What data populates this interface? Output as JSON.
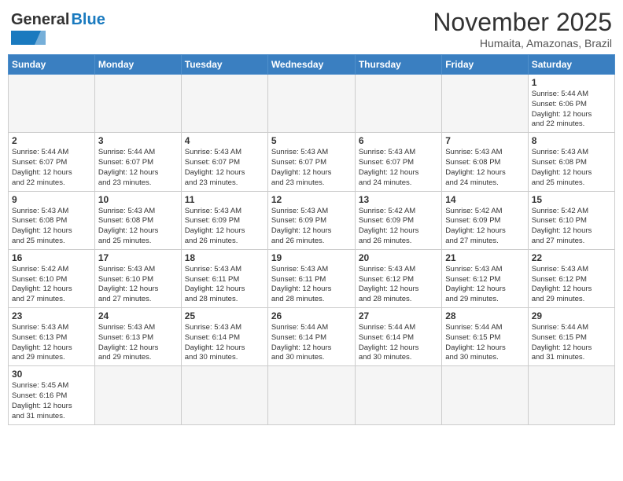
{
  "header": {
    "logo_text_normal": "General",
    "logo_text_blue": "Blue",
    "month_year": "November 2025",
    "location": "Humaita, Amazonas, Brazil"
  },
  "weekdays": [
    "Sunday",
    "Monday",
    "Tuesday",
    "Wednesday",
    "Thursday",
    "Friday",
    "Saturday"
  ],
  "weeks": [
    [
      {
        "day": "",
        "info": ""
      },
      {
        "day": "",
        "info": ""
      },
      {
        "day": "",
        "info": ""
      },
      {
        "day": "",
        "info": ""
      },
      {
        "day": "",
        "info": ""
      },
      {
        "day": "",
        "info": ""
      },
      {
        "day": "1",
        "info": "Sunrise: 5:44 AM\nSunset: 6:06 PM\nDaylight: 12 hours\nand 22 minutes."
      }
    ],
    [
      {
        "day": "2",
        "info": "Sunrise: 5:44 AM\nSunset: 6:07 PM\nDaylight: 12 hours\nand 22 minutes."
      },
      {
        "day": "3",
        "info": "Sunrise: 5:44 AM\nSunset: 6:07 PM\nDaylight: 12 hours\nand 23 minutes."
      },
      {
        "day": "4",
        "info": "Sunrise: 5:43 AM\nSunset: 6:07 PM\nDaylight: 12 hours\nand 23 minutes."
      },
      {
        "day": "5",
        "info": "Sunrise: 5:43 AM\nSunset: 6:07 PM\nDaylight: 12 hours\nand 23 minutes."
      },
      {
        "day": "6",
        "info": "Sunrise: 5:43 AM\nSunset: 6:07 PM\nDaylight: 12 hours\nand 24 minutes."
      },
      {
        "day": "7",
        "info": "Sunrise: 5:43 AM\nSunset: 6:08 PM\nDaylight: 12 hours\nand 24 minutes."
      },
      {
        "day": "8",
        "info": "Sunrise: 5:43 AM\nSunset: 6:08 PM\nDaylight: 12 hours\nand 25 minutes."
      }
    ],
    [
      {
        "day": "9",
        "info": "Sunrise: 5:43 AM\nSunset: 6:08 PM\nDaylight: 12 hours\nand 25 minutes."
      },
      {
        "day": "10",
        "info": "Sunrise: 5:43 AM\nSunset: 6:08 PM\nDaylight: 12 hours\nand 25 minutes."
      },
      {
        "day": "11",
        "info": "Sunrise: 5:43 AM\nSunset: 6:09 PM\nDaylight: 12 hours\nand 26 minutes."
      },
      {
        "day": "12",
        "info": "Sunrise: 5:43 AM\nSunset: 6:09 PM\nDaylight: 12 hours\nand 26 minutes."
      },
      {
        "day": "13",
        "info": "Sunrise: 5:42 AM\nSunset: 6:09 PM\nDaylight: 12 hours\nand 26 minutes."
      },
      {
        "day": "14",
        "info": "Sunrise: 5:42 AM\nSunset: 6:09 PM\nDaylight: 12 hours\nand 27 minutes."
      },
      {
        "day": "15",
        "info": "Sunrise: 5:42 AM\nSunset: 6:10 PM\nDaylight: 12 hours\nand 27 minutes."
      }
    ],
    [
      {
        "day": "16",
        "info": "Sunrise: 5:42 AM\nSunset: 6:10 PM\nDaylight: 12 hours\nand 27 minutes."
      },
      {
        "day": "17",
        "info": "Sunrise: 5:43 AM\nSunset: 6:10 PM\nDaylight: 12 hours\nand 27 minutes."
      },
      {
        "day": "18",
        "info": "Sunrise: 5:43 AM\nSunset: 6:11 PM\nDaylight: 12 hours\nand 28 minutes."
      },
      {
        "day": "19",
        "info": "Sunrise: 5:43 AM\nSunset: 6:11 PM\nDaylight: 12 hours\nand 28 minutes."
      },
      {
        "day": "20",
        "info": "Sunrise: 5:43 AM\nSunset: 6:12 PM\nDaylight: 12 hours\nand 28 minutes."
      },
      {
        "day": "21",
        "info": "Sunrise: 5:43 AM\nSunset: 6:12 PM\nDaylight: 12 hours\nand 29 minutes."
      },
      {
        "day": "22",
        "info": "Sunrise: 5:43 AM\nSunset: 6:12 PM\nDaylight: 12 hours\nand 29 minutes."
      }
    ],
    [
      {
        "day": "23",
        "info": "Sunrise: 5:43 AM\nSunset: 6:13 PM\nDaylight: 12 hours\nand 29 minutes."
      },
      {
        "day": "24",
        "info": "Sunrise: 5:43 AM\nSunset: 6:13 PM\nDaylight: 12 hours\nand 29 minutes."
      },
      {
        "day": "25",
        "info": "Sunrise: 5:43 AM\nSunset: 6:14 PM\nDaylight: 12 hours\nand 30 minutes."
      },
      {
        "day": "26",
        "info": "Sunrise: 5:44 AM\nSunset: 6:14 PM\nDaylight: 12 hours\nand 30 minutes."
      },
      {
        "day": "27",
        "info": "Sunrise: 5:44 AM\nSunset: 6:14 PM\nDaylight: 12 hours\nand 30 minutes."
      },
      {
        "day": "28",
        "info": "Sunrise: 5:44 AM\nSunset: 6:15 PM\nDaylight: 12 hours\nand 30 minutes."
      },
      {
        "day": "29",
        "info": "Sunrise: 5:44 AM\nSunset: 6:15 PM\nDaylight: 12 hours\nand 31 minutes."
      }
    ],
    [
      {
        "day": "30",
        "info": "Sunrise: 5:45 AM\nSunset: 6:16 PM\nDaylight: 12 hours\nand 31 minutes."
      },
      {
        "day": "",
        "info": ""
      },
      {
        "day": "",
        "info": ""
      },
      {
        "day": "",
        "info": ""
      },
      {
        "day": "",
        "info": ""
      },
      {
        "day": "",
        "info": ""
      },
      {
        "day": "",
        "info": ""
      }
    ]
  ]
}
